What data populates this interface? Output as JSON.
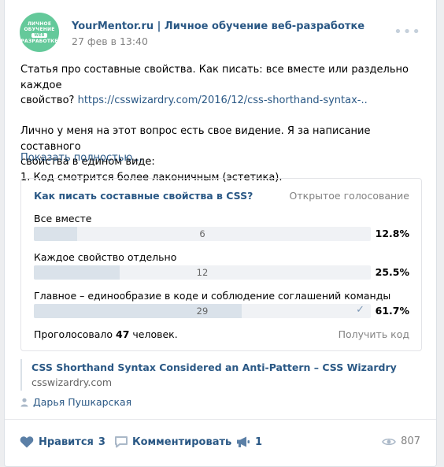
{
  "post": {
    "author": "YourMentor.ru | Личное обучение веб-разработке",
    "date": "27 фев в 13:40",
    "avatar_lines": [
      "ЛИЧНОЕ",
      "ОБУЧЕНИЕ",
      "WEB",
      "РАЗРАБОТКЕ"
    ],
    "text_line1": "Статья про составные свойства. Как писать: все вместе или раздельно каждое",
    "text_line2_prefix": "свойство? ",
    "text_link": "https://csswizardry.com/2016/12/css-shorthand-syntax-..",
    "text_line3": "Лично у меня на этот вопрос есть свое видение. Я за написание составного",
    "text_line4": "свойства в едином виде:",
    "text_line5": "1. Код смотрится более лаконичным (эстетика).",
    "show_full": "Показать полностью…"
  },
  "poll": {
    "title": "Как писать составные свойства в CSS?",
    "type": "Открытое голосование",
    "options": [
      {
        "label": "Все вместе",
        "count": "6",
        "percent": "12.8%",
        "fill": 0.128
      },
      {
        "label": "Каждое свойство отдельно",
        "count": "12",
        "percent": "25.5%",
        "fill": 0.255
      },
      {
        "label": "Главное – единообразие в коде и соблюдение соглашений команды",
        "count": "29",
        "percent": "61.7%",
        "fill": 0.617
      }
    ],
    "voted_prefix": "Проголосовало ",
    "voted_count": "47",
    "voted_suffix": " человек.",
    "get_code": "Получить код"
  },
  "link": {
    "title": "CSS Shorthand Syntax Considered an Anti-Pattern – CSS Wizardry",
    "domain": "csswizardry.com"
  },
  "signer": "Дарья Пушкарская",
  "footer": {
    "like_label": "Нравится",
    "like_count": "3",
    "comment_label": "Комментировать",
    "share_count": "1",
    "views": "807"
  },
  "colors": {
    "accent": "#2a5885",
    "avatar": "#64c99a",
    "bar_fill": "#dae2ea",
    "bar_bg": "#f0f2f5"
  }
}
